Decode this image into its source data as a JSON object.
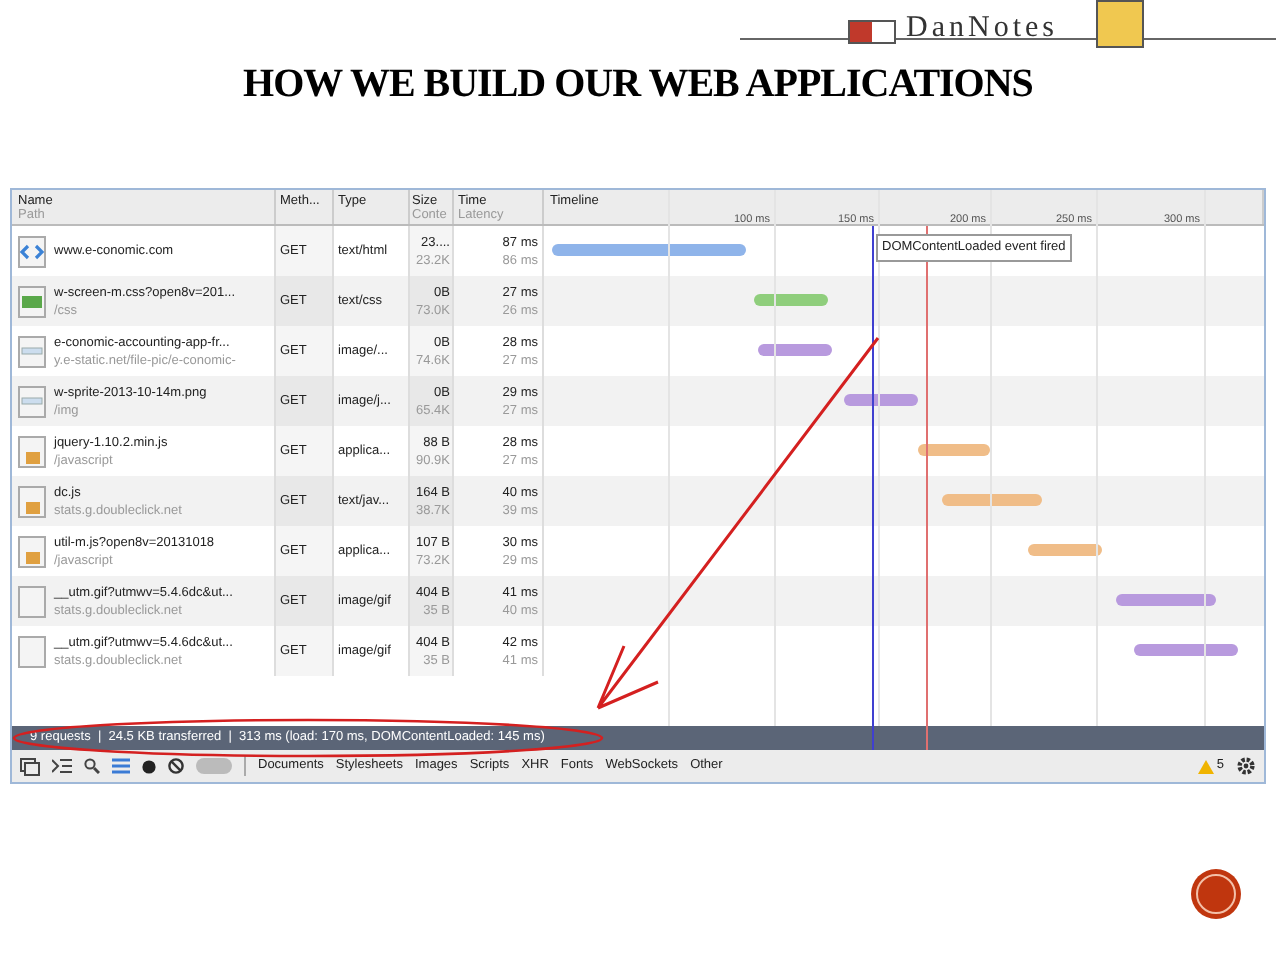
{
  "slide": {
    "title": "HOW WE BUILD OUR WEB APPLICATIONS",
    "logo_text": "DanNotes"
  },
  "table": {
    "columns": [
      {
        "label": "Name",
        "sub": "Path"
      },
      {
        "label": "Meth..."
      },
      {
        "label": "Type"
      },
      {
        "label": "Size",
        "sub": "Conte"
      },
      {
        "label": "Time",
        "sub": "Latency"
      },
      {
        "label": "Timeline"
      }
    ],
    "ticks": [
      "100 ms",
      "150 ms",
      "200 ms",
      "250 ms",
      "300 ms"
    ],
    "tooltip": "DOMContentLoaded event fired",
    "rows": [
      {
        "kind": "html",
        "name": "www.e-conomic.com",
        "path": "",
        "method": "GET",
        "type": "text/html",
        "size": "23....",
        "content": "23.2K",
        "time": "87 ms",
        "latency": "86 ms",
        "color": "#8fb4ea"
      },
      {
        "kind": "css",
        "name": "w-screen-m.css?open8v=201...",
        "path": "/css",
        "method": "GET",
        "type": "text/css",
        "size": "0B",
        "content": "73.0K",
        "time": "27 ms",
        "latency": "26 ms",
        "color": "#8fce7c"
      },
      {
        "kind": "image",
        "name": "e-conomic-accounting-app-fr...",
        "path": "y.e-static.net/file-pic/e-conomic-",
        "method": "GET",
        "type": "image/...",
        "size": "0B",
        "content": "74.6K",
        "time": "28 ms",
        "latency": "27 ms",
        "color": "#b89ade"
      },
      {
        "kind": "image",
        "name": "w-sprite-2013-10-14m.png",
        "path": "/img",
        "method": "GET",
        "type": "image/j...",
        "size": "0B",
        "content": "65.4K",
        "time": "29 ms",
        "latency": "27 ms",
        "color": "#b89ade"
      },
      {
        "kind": "js",
        "name": "jquery-1.10.2.min.js",
        "path": "/javascript",
        "method": "GET",
        "type": "applica...",
        "size": "88 B",
        "content": "90.9K",
        "time": "28 ms",
        "latency": "27 ms",
        "color": "#f0bd88"
      },
      {
        "kind": "js",
        "name": "dc.js",
        "path": "stats.g.doubleclick.net",
        "method": "GET",
        "type": "text/jav...",
        "size": "164 B",
        "content": "38.7K",
        "time": "40 ms",
        "latency": "39 ms",
        "color": "#f0bd88"
      },
      {
        "kind": "js",
        "name": "util-m.js?open8v=20131018",
        "path": "/javascript",
        "method": "GET",
        "type": "applica...",
        "size": "107 B",
        "content": "73.2K",
        "time": "30 ms",
        "latency": "29 ms",
        "color": "#f0bd88"
      },
      {
        "kind": "blank",
        "name": "__utm.gif?utmwv=5.4.6dc&ut...",
        "path": "stats.g.doubleclick.net",
        "method": "GET",
        "type": "image/gif",
        "size": "404 B",
        "content": "35 B",
        "time": "41 ms",
        "latency": "40 ms",
        "color": "#b89ade"
      },
      {
        "kind": "blank",
        "name": "__utm.gif?utmwv=5.4.6dc&ut...",
        "path": "stats.g.doubleclick.net",
        "method": "GET",
        "type": "image/gif",
        "size": "404 B",
        "content": "35 B",
        "time": "42 ms",
        "latency": "41 ms",
        "color": "#b89ade"
      }
    ]
  },
  "status_bar": "9 requests  |  24.5 KB transferred  |  313 ms (load: 170 ms, DOMContentLoaded: 145 ms)",
  "toolbar": {
    "filters": [
      {
        "label": "Documents"
      },
      {
        "label": "Stylesheets"
      },
      {
        "label": "Images"
      },
      {
        "label": "Scripts"
      },
      {
        "label": "XHR"
      },
      {
        "label": "Fonts"
      },
      {
        "label": "WebSockets"
      },
      {
        "label": "Other"
      }
    ],
    "warnings": "5"
  }
}
